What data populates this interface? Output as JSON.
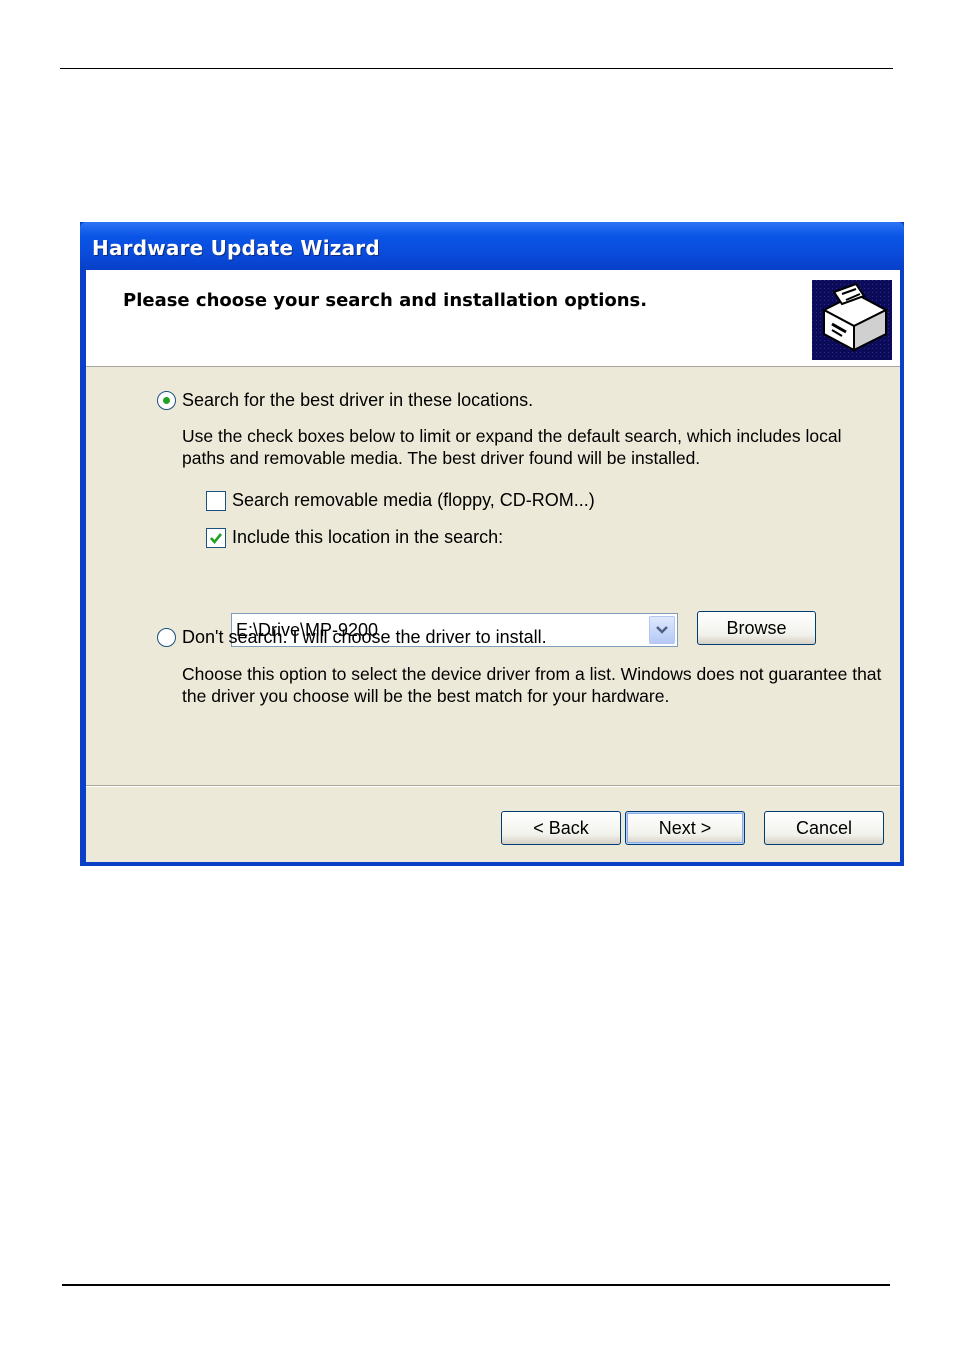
{
  "window": {
    "title": "Hardware Update Wizard"
  },
  "header": {
    "title": "Please choose your search and installation options."
  },
  "options": {
    "search": {
      "label": "Search for the best driver in these locations.",
      "selected": true,
      "description_line1": "Use the check boxes below to limit or expand the default search, which includes local",
      "description_line2": "paths and removable media. The best driver found will be installed.",
      "removable_media": {
        "label": "Search removable media (floppy, CD-ROM...)",
        "checked": false
      },
      "include_location": {
        "label": "Include this location in the search:",
        "checked": true
      },
      "location_value": "E:\\Drive\\MP-9200",
      "browse_label": "Browse"
    },
    "dont_search": {
      "label": "Don't search. I will choose the driver to install.",
      "selected": false,
      "description_line1": "Choose this option to select the device driver from a list.  Windows does not guarantee that",
      "description_line2": "the driver you choose will be the best match for your hardware."
    }
  },
  "buttons": {
    "back": "< Back",
    "next": "Next >",
    "cancel": "Cancel"
  },
  "colors": {
    "titlebar": "#0a4ad9",
    "client_background": "#ece9d8",
    "header_icon_background": "#0b0b5a"
  },
  "icons": {
    "header": "hardware-install-icon"
  }
}
